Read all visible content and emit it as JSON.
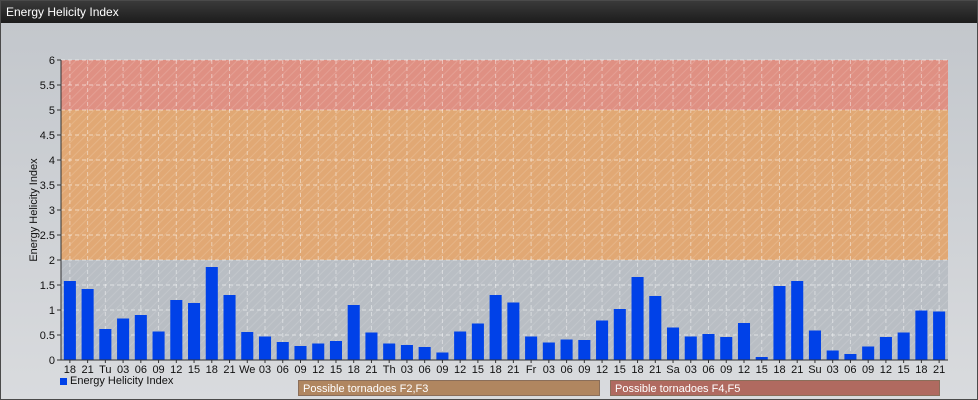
{
  "window": {
    "title": "Energy Helicity Index"
  },
  "legend": {
    "series_label": "Energy Helicity Index"
  },
  "bands": [
    {
      "label": "Possible tornadoes F2,F3",
      "from": 2,
      "to": 5,
      "color": "#e7a466"
    },
    {
      "label": "Possible tornadoes F4,F5",
      "from": 5,
      "to": 6,
      "color": "#e58878"
    }
  ],
  "chart_data": {
    "type": "bar",
    "ylabel": "Energy Helicity Index",
    "ylim": [
      0,
      6
    ],
    "yticks": [
      "0",
      "0.5",
      "1",
      "1.5",
      "2",
      "2.5",
      "3",
      "3.5",
      "4",
      "4.5",
      "5",
      "5.5",
      "6"
    ],
    "grid": true,
    "legend_position": "bottom-left",
    "categories": [
      "18",
      "21",
      "Tu",
      "03",
      "06",
      "09",
      "12",
      "15",
      "18",
      "21",
      "We",
      "03",
      "06",
      "09",
      "12",
      "15",
      "18",
      "21",
      "Th",
      "03",
      "06",
      "09",
      "12",
      "15",
      "18",
      "21",
      "Fr",
      "03",
      "06",
      "09",
      "12",
      "15",
      "18",
      "21",
      "Sa",
      "03",
      "06",
      "09",
      "12",
      "15",
      "18",
      "21",
      "Su",
      "03",
      "06",
      "09",
      "12",
      "15",
      "18",
      "21"
    ],
    "series": [
      {
        "name": "Energy Helicity Index",
        "color": "#0041e8",
        "values": [
          1.58,
          1.42,
          0.62,
          0.83,
          0.9,
          0.57,
          1.2,
          1.14,
          1.86,
          1.3,
          0.56,
          0.47,
          0.36,
          0.28,
          0.33,
          0.38,
          1.1,
          0.55,
          0.33,
          0.3,
          0.26,
          0.15,
          0.57,
          0.73,
          1.3,
          1.15,
          0.47,
          0.35,
          0.41,
          0.4,
          0.79,
          1.02,
          1.66,
          1.28,
          0.65,
          0.47,
          0.52,
          0.46,
          0.74,
          0.06,
          1.48,
          1.58,
          0.59,
          0.19,
          0.12,
          0.27,
          0.46,
          0.55,
          0.99,
          0.97
        ]
      }
    ]
  }
}
